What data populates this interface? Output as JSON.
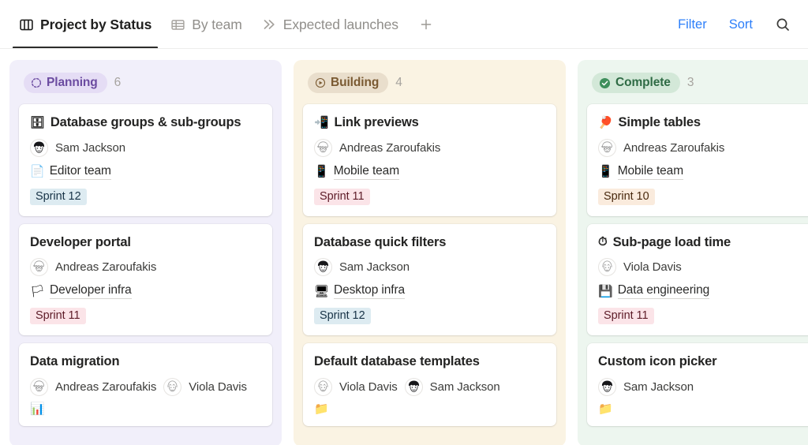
{
  "header": {
    "tabs": [
      {
        "label": "Project by Status",
        "icon": "board-columns-icon",
        "active": true
      },
      {
        "label": "By team",
        "icon": "table-grid-icon",
        "active": false
      },
      {
        "label": "Expected launches",
        "icon": "chevrons-right-icon",
        "active": false
      }
    ],
    "add_view_label": "+",
    "filter_label": "Filter",
    "sort_label": "Sort",
    "search_icon": "search-icon",
    "accent_color": "#2d7ff9"
  },
  "board": {
    "columns": [
      {
        "status": "Planning",
        "count": "6",
        "status_icon": "dashed-circle-icon",
        "bg": "#f1effa",
        "pill_bg": "#e5ddf5",
        "pill_fg": "#6b4ba0",
        "cards": [
          {
            "title": "Database groups & sub-groups",
            "emoji": "🗄",
            "people": [
              {
                "name": "Sam Jackson",
                "avatar": "sam-jackson"
              }
            ],
            "team": "Editor team",
            "team_emoji": "📄",
            "sprint": "Sprint 12",
            "sprint_style": "blue"
          },
          {
            "title": "Developer portal",
            "emoji": "",
            "people": [
              {
                "name": "Andreas Zaroufakis",
                "avatar": "andreas-zaroufakis"
              }
            ],
            "team": "Developer infra",
            "team_emoji": "🏳",
            "sprint": "Sprint 11",
            "sprint_style": "pink"
          },
          {
            "title": "Data migration",
            "emoji": "",
            "people": [
              {
                "name": "Andreas Zaroufakis",
                "avatar": "andreas-zaroufakis"
              },
              {
                "name": "Viola Davis",
                "avatar": "viola-davis"
              }
            ],
            "team": "",
            "team_emoji": "📊",
            "sprint": "",
            "sprint_style": "blue",
            "clipped": true
          }
        ]
      },
      {
        "status": "Building",
        "count": "4",
        "status_icon": "play-circle-icon",
        "bg": "#faf3e3",
        "pill_bg": "#e9decc",
        "pill_fg": "#7a5a32",
        "cards": [
          {
            "title": "Link previews",
            "emoji": "📲",
            "people": [
              {
                "name": "Andreas Zaroufakis",
                "avatar": "andreas-zaroufakis"
              }
            ],
            "team": "Mobile team",
            "team_emoji": "📱",
            "sprint": "Sprint 11",
            "sprint_style": "pink"
          },
          {
            "title": "Database quick filters",
            "emoji": "",
            "people": [
              {
                "name": "Sam Jackson",
                "avatar": "sam-jackson"
              }
            ],
            "team": "Desktop infra",
            "team_emoji": "🖥",
            "sprint": "Sprint 12",
            "sprint_style": "blue"
          },
          {
            "title": "Default database templates",
            "emoji": "",
            "people": [
              {
                "name": "Viola Davis",
                "avatar": "viola-davis"
              },
              {
                "name": "Sam Jackson",
                "avatar": "sam-jackson"
              }
            ],
            "team": "",
            "team_emoji": "📁",
            "sprint": "",
            "sprint_style": "blue",
            "clipped": true
          }
        ]
      },
      {
        "status": "Complete",
        "count": "3",
        "status_icon": "check-circle-icon",
        "bg": "#edf6ef",
        "pill_bg": "#d3e8d8",
        "pill_fg": "#2f6b45",
        "cards": [
          {
            "title": "Simple tables",
            "emoji": "🏓",
            "people": [
              {
                "name": "Andreas Zaroufakis",
                "avatar": "andreas-zaroufakis"
              }
            ],
            "team": "Mobile team",
            "team_emoji": "📱",
            "sprint": "Sprint 10",
            "sprint_style": "orange"
          },
          {
            "title": "Sub-page load time",
            "emoji": "⏱",
            "people": [
              {
                "name": "Viola Davis",
                "avatar": "viola-davis"
              }
            ],
            "team": "Data engineering",
            "team_emoji": "💾",
            "sprint": "Sprint 11",
            "sprint_style": "pink"
          },
          {
            "title": "Custom icon picker",
            "emoji": "",
            "people": [
              {
                "name": "Sam Jackson",
                "avatar": "sam-jackson"
              }
            ],
            "team": "",
            "team_emoji": "📁",
            "sprint": "",
            "sprint_style": "blue",
            "clipped": true
          }
        ]
      }
    ]
  }
}
